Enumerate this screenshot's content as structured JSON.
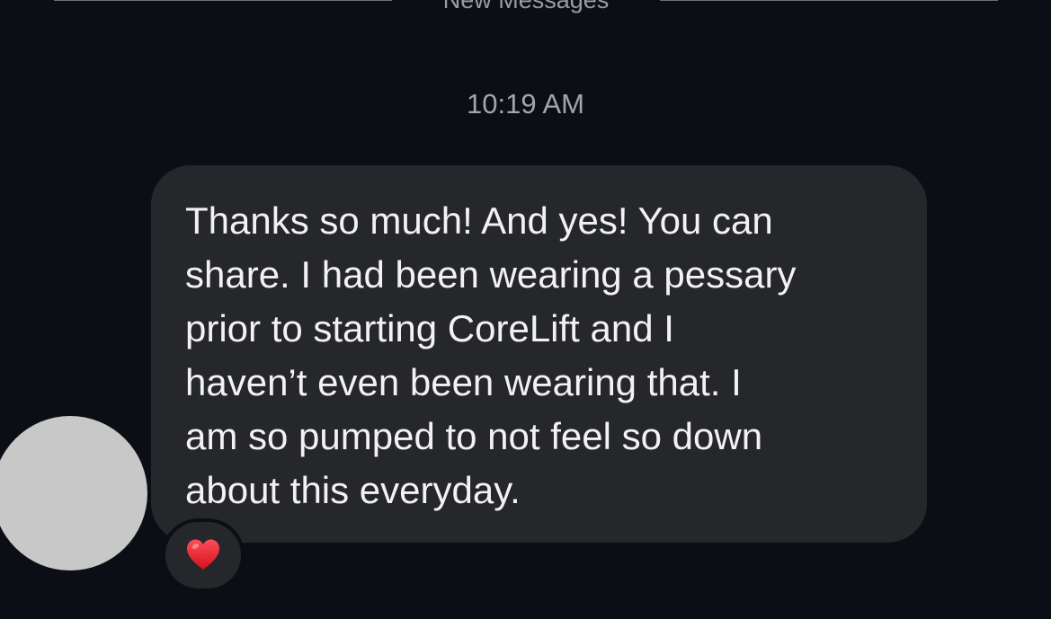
{
  "divider": {
    "label": "New Messages"
  },
  "timestamp": "10:19 AM",
  "message": {
    "text": "Thanks so much! And yes! You can\nshare. I had been wearing a pessary\nprior to starting CoreLift and I\nhaven’t even been wearing that. I\nam so pumped to not feel so down\nabout this everyday."
  },
  "reaction": {
    "icon": "heart-icon",
    "color": "#e8242f"
  },
  "colors": {
    "background": "#0b0e15",
    "bubble": "#26272b",
    "avatar_placeholder": "#c8c8c8"
  }
}
